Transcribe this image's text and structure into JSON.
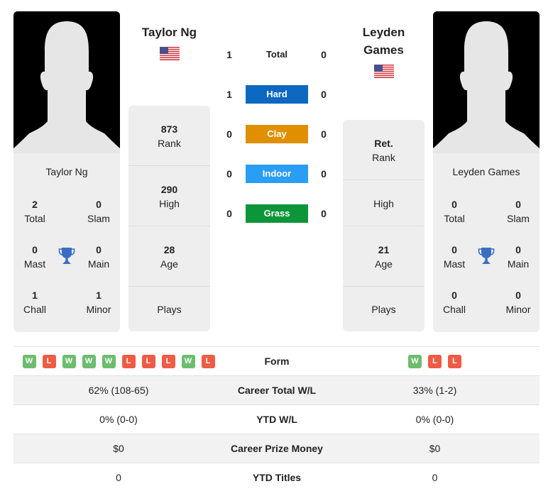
{
  "colors": {
    "hard": "#0c68c0",
    "clay": "#df8f00",
    "indoor": "#2a9df4",
    "grass": "#0c9639",
    "form_win": "#6cbd6e",
    "form_loss": "#ef5b45",
    "trophy": "#3a6fbf"
  },
  "player1": {
    "name": "Taylor Ng",
    "header_name": "Taylor Ng",
    "flag_icon": "us-flag-icon",
    "titles": {
      "total": {
        "value": "2",
        "label": "Total"
      },
      "slam": {
        "value": "0",
        "label": "Slam"
      },
      "mast": {
        "value": "0",
        "label": "Mast"
      },
      "main": {
        "value": "0",
        "label": "Main"
      },
      "chall": {
        "value": "1",
        "label": "Chall"
      },
      "minor": {
        "value": "1",
        "label": "Minor"
      }
    },
    "stats": {
      "rank": {
        "value": "873",
        "label": "Rank"
      },
      "high": {
        "value": "290",
        "label": "High"
      },
      "age": {
        "value": "28",
        "label": "Age"
      },
      "plays": {
        "value": "",
        "label": "Plays"
      }
    },
    "form": [
      "W",
      "L",
      "W",
      "W",
      "W",
      "L",
      "L",
      "L",
      "W",
      "L"
    ],
    "career_wl": "62% (108-65)",
    "ytd_wl": "0% (0-0)",
    "prize_money": "$0",
    "ytd_titles": "0"
  },
  "player2": {
    "name": "Leyden Games",
    "header_name_line1": "Leyden",
    "header_name_line2": "Games",
    "flag_icon": "us-flag-icon",
    "titles": {
      "total": {
        "value": "0",
        "label": "Total"
      },
      "slam": {
        "value": "0",
        "label": "Slam"
      },
      "mast": {
        "value": "0",
        "label": "Mast"
      },
      "main": {
        "value": "0",
        "label": "Main"
      },
      "chall": {
        "value": "0",
        "label": "Chall"
      },
      "minor": {
        "value": "0",
        "label": "Minor"
      }
    },
    "stats": {
      "rank": {
        "value": "Ret.",
        "label": "Rank"
      },
      "high": {
        "value": "",
        "label": "High"
      },
      "age": {
        "value": "21",
        "label": "Age"
      },
      "plays": {
        "value": "",
        "label": "Plays"
      }
    },
    "form": [
      "W",
      "L",
      "L"
    ],
    "career_wl": "33% (1-2)",
    "ytd_wl": "0% (0-0)",
    "prize_money": "$0",
    "ytd_titles": "0"
  },
  "h2h": [
    {
      "surface": "Total",
      "p1": "1",
      "p2": "0"
    },
    {
      "surface": "Hard",
      "p1": "1",
      "p2": "0"
    },
    {
      "surface": "Clay",
      "p1": "0",
      "p2": "0"
    },
    {
      "surface": "Indoor",
      "p1": "0",
      "p2": "0"
    },
    {
      "surface": "Grass",
      "p1": "0",
      "p2": "0"
    }
  ],
  "comparison_labels": {
    "form": "Form",
    "career_wl": "Career Total W/L",
    "ytd_wl": "YTD W/L",
    "prize_money": "Career Prize Money",
    "ytd_titles": "YTD Titles"
  }
}
